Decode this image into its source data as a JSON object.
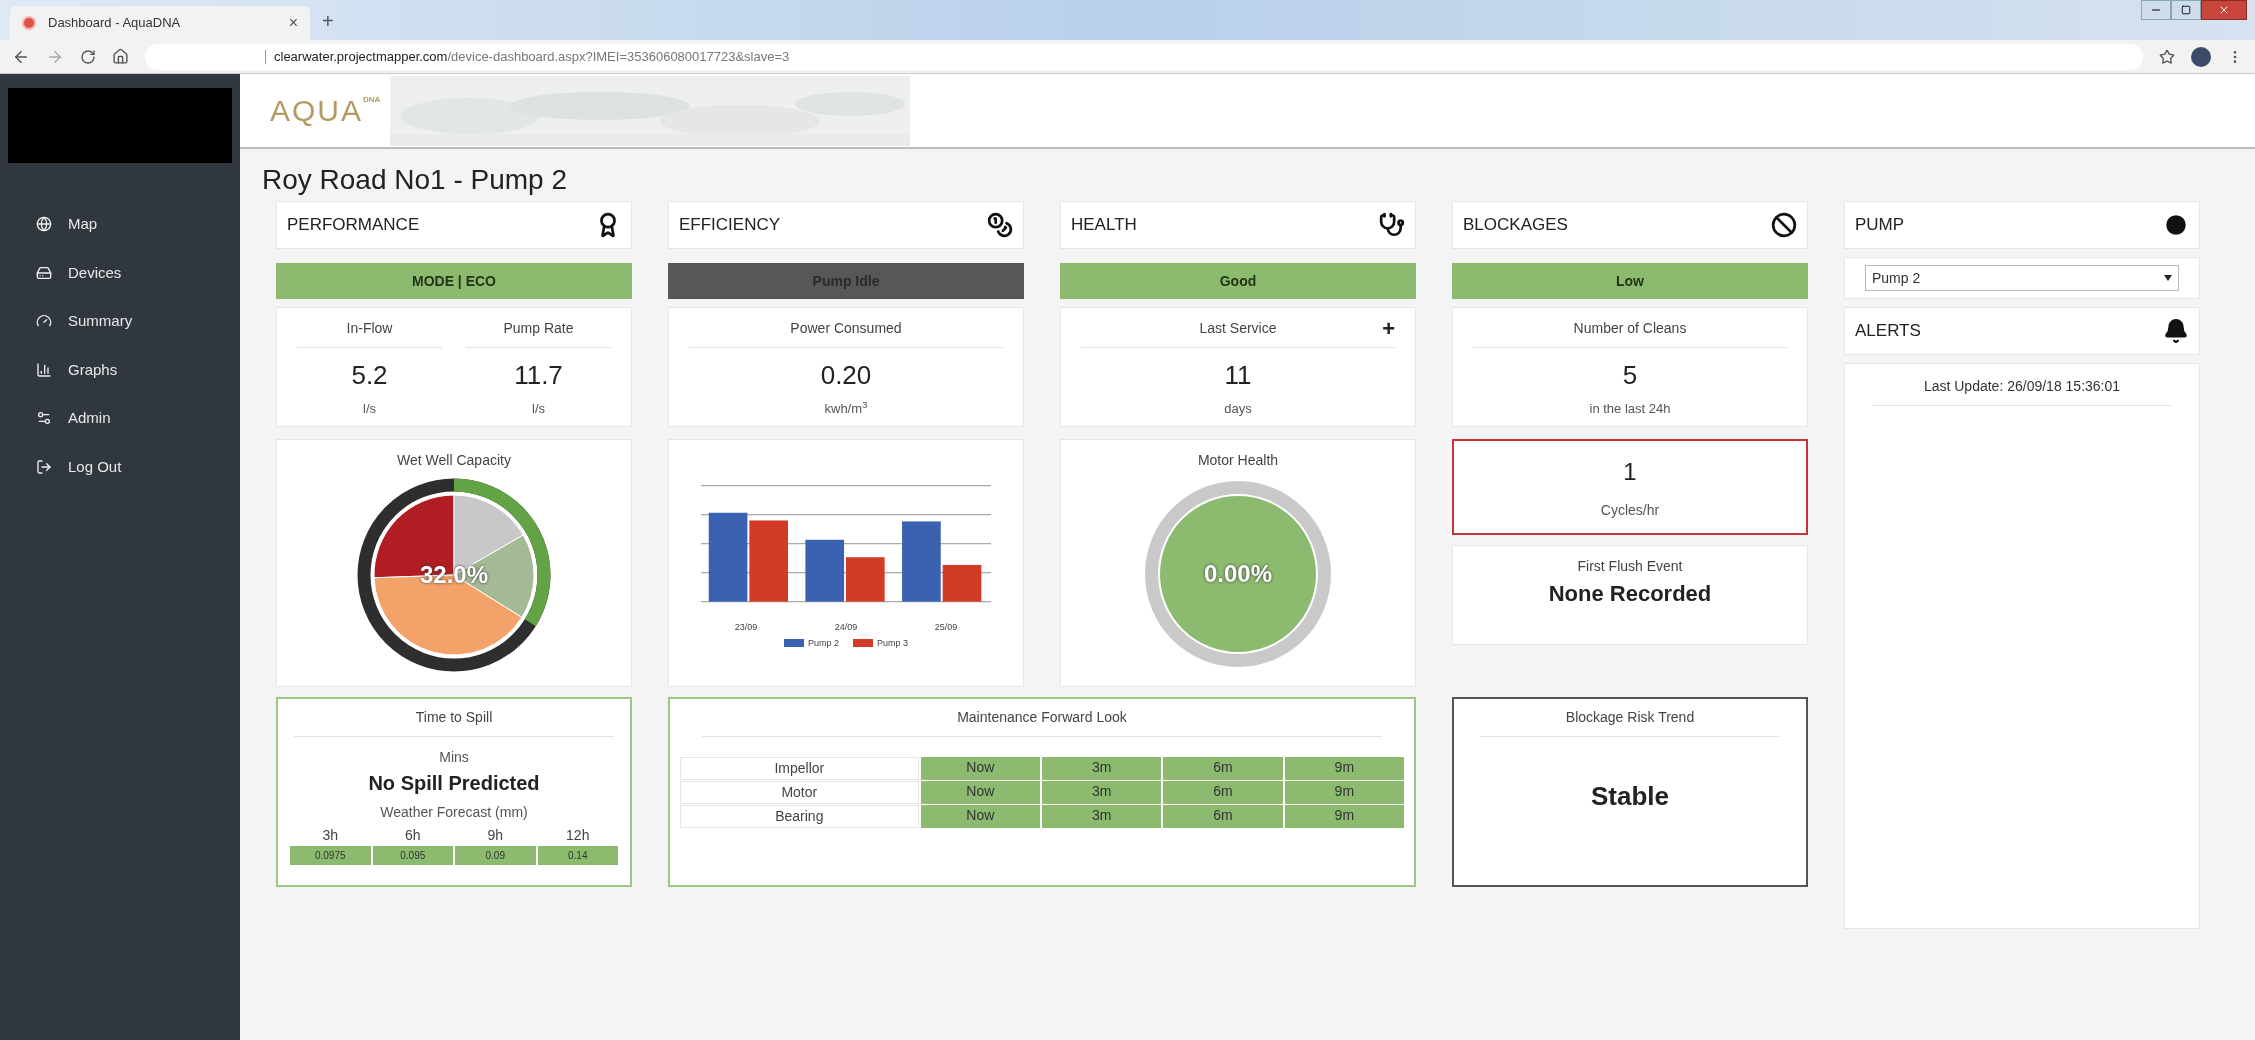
{
  "browser": {
    "tab_title": "Dashboard - AquaDNA",
    "tab_close": "×",
    "new_tab": "+",
    "url_host": "clearwater.projectmapper.com",
    "url_path": "/device-dashboard.aspx?IMEI=353606080017723&slave=3"
  },
  "logo": {
    "main": "AQUA",
    "superscript": "DNA"
  },
  "sidebar": {
    "items": [
      {
        "label": "Map"
      },
      {
        "label": "Devices"
      },
      {
        "label": "Summary"
      },
      {
        "label": "Graphs"
      },
      {
        "label": "Admin"
      },
      {
        "label": "Log Out"
      }
    ]
  },
  "page_title": "Roy Road No1 - Pump 2",
  "panels": [
    {
      "title": "PERFORMANCE",
      "status": {
        "label": "MODE | ECO",
        "color": "#8cbb6f"
      },
      "stats": [
        {
          "label": "In-Flow",
          "value": "5.2",
          "unit": "l/s"
        },
        {
          "label": "Pump Rate",
          "value": "11.7",
          "unit": "l/s"
        }
      ],
      "chart": {
        "kind": "pie",
        "title": "Wet Well Capacity",
        "reading": "32.0%"
      }
    },
    {
      "title": "EFFICIENCY",
      "status": {
        "label": "Pump Idle",
        "color": "#575757"
      },
      "stats": [
        {
          "label": "Power Consumed",
          "value": "0.20",
          "unit": "kwh/m$^{3}$"
        }
      ],
      "chart": {
        "kind": "bars",
        "categories": [
          "23/09",
          "24/09",
          "25/09"
        ],
        "legend": [
          {
            "name": "Pump 2",
            "color": "#3a62b0"
          },
          {
            "name": "Pump 3",
            "color": "#d23c26"
          }
        ]
      }
    },
    {
      "title": "HEALTH",
      "status": {
        "label": "Good",
        "color": "#8cbb6f"
      },
      "stats": [
        {
          "label": "Last Service",
          "value": "11",
          "unit": "days",
          "action": "+"
        }
      ],
      "chart": {
        "kind": "gauge",
        "title": "Motor Health",
        "reading": "0.00%"
      }
    },
    {
      "title": "BLOCKAGES",
      "status": {
        "label": "Low",
        "color": "#8cbb6f"
      },
      "stats": [
        {
          "label": "Number of Cleans",
          "value": "5",
          "unit": "in the last 24h"
        }
      ],
      "chart": {
        "kind": "cards",
        "cycles": {
          "value": "1",
          "unit": "Cycles/hr",
          "alert": true
        },
        "flush": {
          "label": "First Flush Event",
          "value": "None Recorded"
        }
      }
    }
  ],
  "bottom": [
    {
      "kind": "spill",
      "title": "Time to Spill",
      "unit_label": "Mins",
      "value": "No Spill Predicted",
      "forecast_title": "Weather Forecast (mm)",
      "forecast": [
        {
          "period": "3h",
          "value": "0.0975"
        },
        {
          "period": "6h",
          "value": "0.095"
        },
        {
          "period": "9h",
          "value": "0.09"
        },
        {
          "period": "12h",
          "value": "0.14"
        }
      ]
    },
    {
      "kind": "maintenance",
      "title": "Maintenance Forward Look",
      "rows": [
        {
          "part": "Impellor",
          "cells": [
            "Now",
            "3m",
            "6m",
            "9m"
          ]
        },
        {
          "part": "Motor",
          "cells": [
            "Now",
            "3m",
            "6m",
            "9m"
          ]
        },
        {
          "part": "Bearing",
          "cells": [
            "Now",
            "3m",
            "6m",
            "9m"
          ]
        }
      ]
    },
    {
      "kind": "trend",
      "title": "Blockage Risk Trend",
      "value": "Stable"
    }
  ],
  "pump": {
    "title": "PUMP",
    "selected": "Pump 2",
    "alerts_title": "ALERTS",
    "last_update": "Last Update: 26/09/18 15:36:01"
  }
}
